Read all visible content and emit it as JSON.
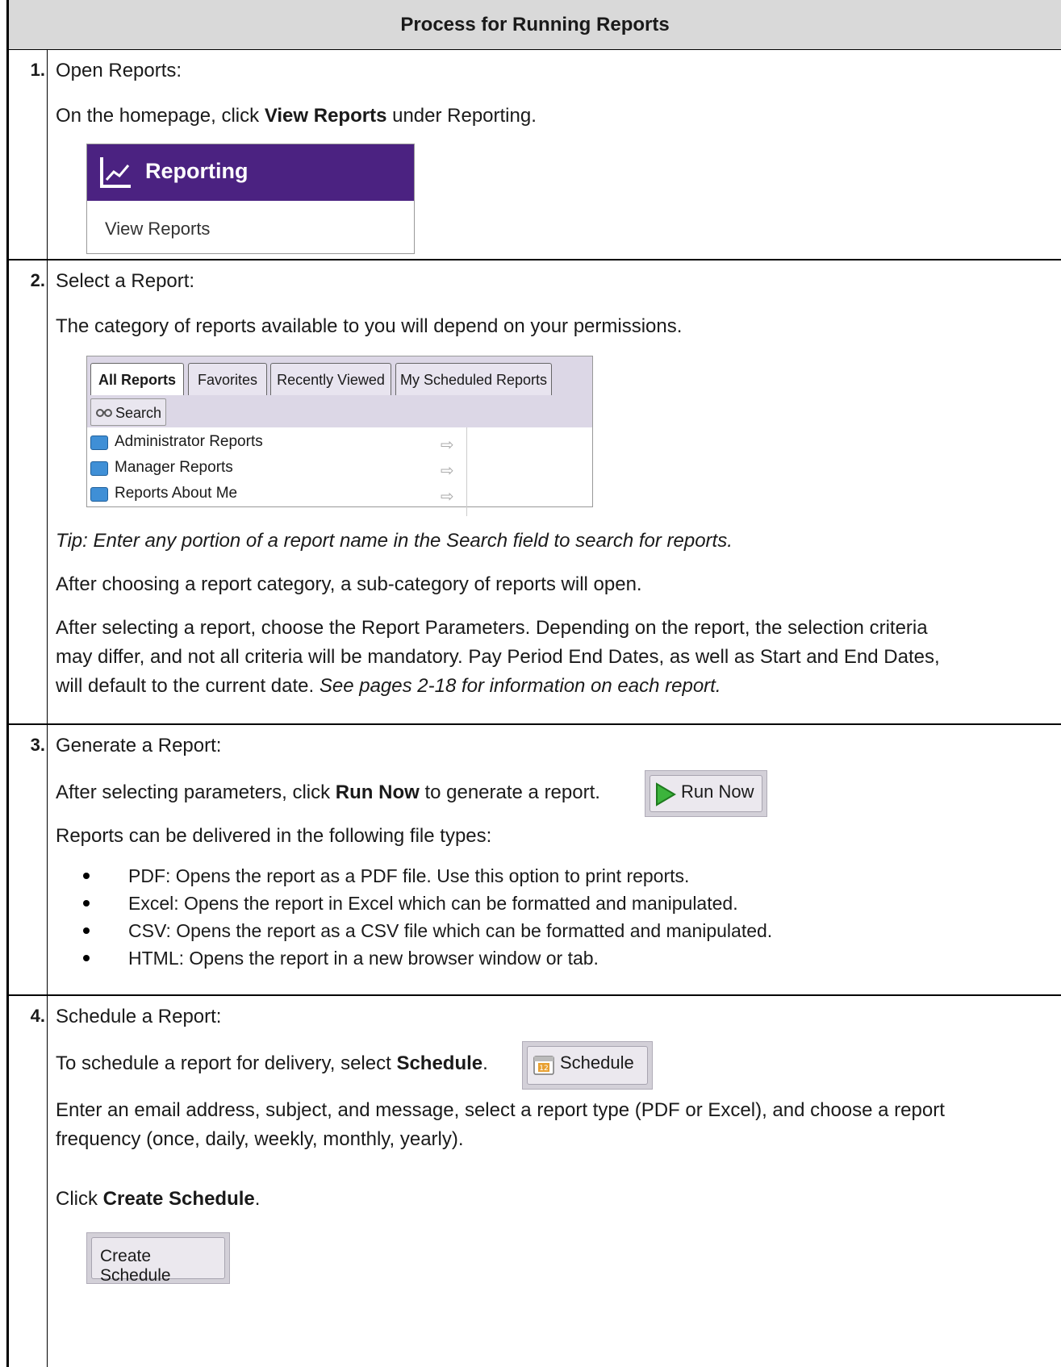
{
  "header": {
    "title": "Process for Running Reports"
  },
  "step1": {
    "num": "1.",
    "title": "Open Reports:",
    "text_pre": "On the homepage, click ",
    "text_bold": "View Reports",
    "text_post": " under Reporting.",
    "widget": {
      "title": "Reporting",
      "link": "View Reports",
      "bar_color": "#4b2281"
    }
  },
  "step2": {
    "num": "2.",
    "title": "Select a Report:",
    "intro": "The category of reports available to you will depend on your permissions.",
    "tabs": [
      "All Reports",
      "Favorites",
      "Recently Viewed",
      "My Scheduled Reports"
    ],
    "search_label": "Search",
    "items": [
      "Administrator Reports",
      "Manager Reports",
      "Reports About Me"
    ],
    "tip": "Tip: Enter any portion of a report name in the Search field to search for reports.",
    "sub": "After choosing a report category, a sub-category of reports will open.",
    "params_1": "After selecting a report, choose the Report Parameters. Depending on the report, the selection criteria",
    "params_2": "may differ, and not all criteria will be mandatory. Pay Period End Dates, as well as Start and End Dates,",
    "params_3": "will default to the current date. ",
    "params_italic": "See pages 2-18 for information on each report."
  },
  "step3": {
    "num": "3.",
    "title": "Generate a Report:",
    "text_pre": "After selecting parameters, click ",
    "text_bold": "Run Now",
    "text_post": " to generate a report.",
    "button": "Run Now",
    "filetypes_intro": "Reports can be delivered in the following file types:",
    "bullets": [
      "PDF: Opens the report as a PDF file. Use this option to print reports.",
      "Excel: Opens the report in Excel which can be formatted and manipulated.",
      "CSV: Opens the report as a CSV file which can be formatted and manipulated.",
      "HTML: Opens the report in a new browser window or tab."
    ]
  },
  "step4": {
    "num": "4.",
    "title": "Schedule a Report:",
    "text_pre": "To schedule a report for delivery, select ",
    "text_bold": "Schedule",
    "text_post": ".",
    "button": "Schedule",
    "calendar_day": "12",
    "details_1": "Enter an email address, subject, and message, select a report type (PDF or Excel), and choose a report",
    "details_2": "frequency (once, daily, weekly, monthly, yearly).",
    "click_pre": "Click ",
    "click_bold": "Create Schedule",
    "click_post": ".",
    "create_button": "Create Schedule"
  }
}
